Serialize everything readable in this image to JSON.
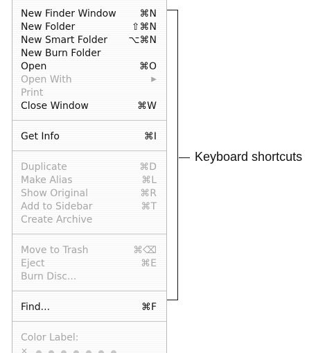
{
  "menu": {
    "groups": [
      [
        {
          "label": "New Finder Window",
          "shortcut": "⌘N",
          "enabled": true
        },
        {
          "label": "New Folder",
          "shortcut": "⇧⌘N",
          "enabled": true
        },
        {
          "label": "New Smart Folder",
          "shortcut": "⌥⌘N",
          "enabled": true
        },
        {
          "label": "New Burn Folder",
          "shortcut": "",
          "enabled": true
        },
        {
          "label": "Open",
          "shortcut": "⌘O",
          "enabled": true
        },
        {
          "label": "Open With",
          "shortcut": "▶",
          "enabled": false
        },
        {
          "label": "Print",
          "shortcut": "",
          "enabled": false
        },
        {
          "label": "Close Window",
          "shortcut": "⌘W",
          "enabled": true
        }
      ],
      [
        {
          "label": "Get Info",
          "shortcut": "⌘I",
          "enabled": true
        }
      ],
      [
        {
          "label": "Duplicate",
          "shortcut": "⌘D",
          "enabled": false
        },
        {
          "label": "Make Alias",
          "shortcut": "⌘L",
          "enabled": false
        },
        {
          "label": "Show Original",
          "shortcut": "⌘R",
          "enabled": false
        },
        {
          "label": "Add to Sidebar",
          "shortcut": "⌘T",
          "enabled": false
        },
        {
          "label": "Create Archive",
          "shortcut": "",
          "enabled": false
        }
      ],
      [
        {
          "label": "Move to Trash",
          "shortcut": "⌘⌫",
          "enabled": false
        },
        {
          "label": "Eject",
          "shortcut": "⌘E",
          "enabled": false
        },
        {
          "label": "Burn Disc...",
          "shortcut": "",
          "enabled": false
        }
      ],
      [
        {
          "label": "Find...",
          "shortcut": "⌘F",
          "enabled": true
        }
      ]
    ],
    "color_label": {
      "title": "Color Label:",
      "clear_symbol": "×",
      "dot_count": 7
    }
  },
  "annotation": {
    "label": "Keyboard shortcuts"
  },
  "colors": {
    "enabled_text": "#111111",
    "disabled_text": "#a6a6a6",
    "separator": "#c8c8c8"
  }
}
